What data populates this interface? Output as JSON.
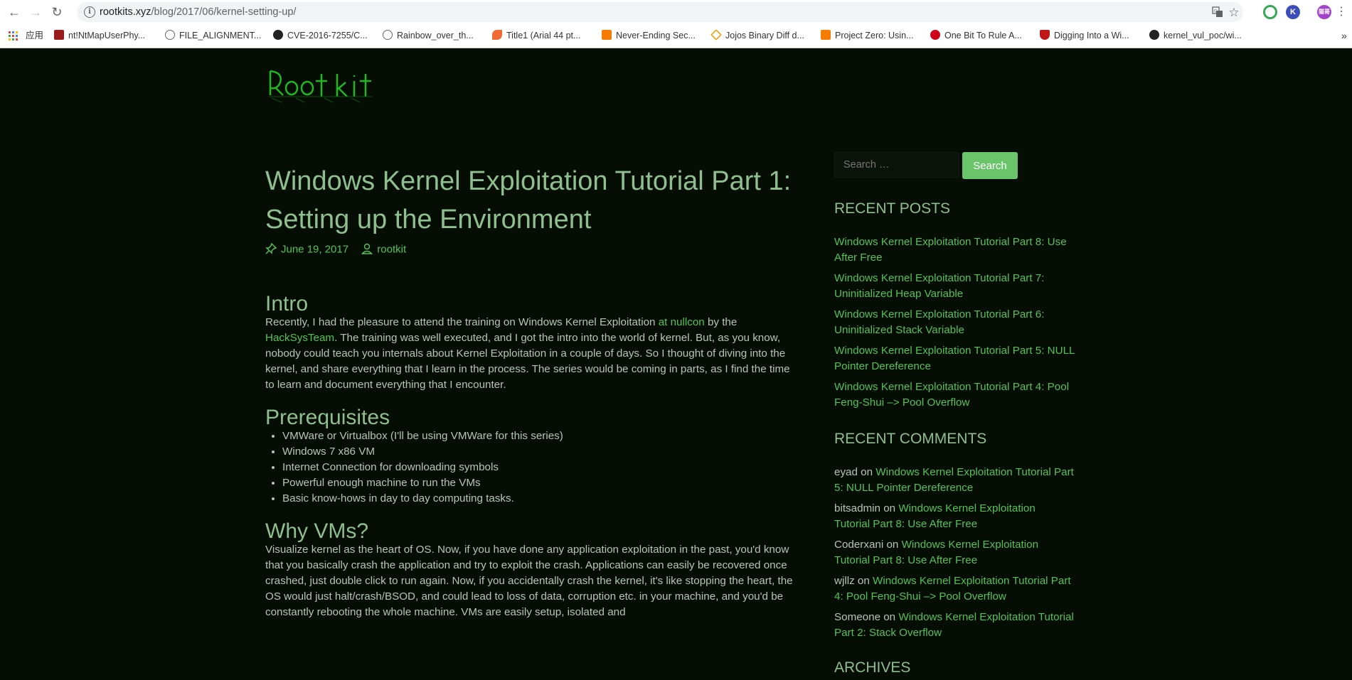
{
  "browser": {
    "url_host": "rootkits.xyz",
    "url_path": "/blog/2017/06/kernel-setting-up/",
    "apps_label": "应用",
    "bookmarks": [
      "nt!NtMapUserPhy...",
      "FILE_ALIGNMENT...",
      "CVE-2016-7255/C...",
      "Rainbow_over_th...",
      "Title1 (Arial 44 pt...",
      "Never-Ending Sec...",
      "Jojos Binary Diff d...",
      "Project Zero: Usin...",
      "One Bit To Rule A...",
      "Digging Into a Wi...",
      "kernel_vul_poc/wi..."
    ],
    "profile_label": "猫哥"
  },
  "post": {
    "title_line1": "Windows Kernel Exploitation Tutorial Part 1:",
    "title_line2": "Setting up the Environment",
    "date": "June 19, 2017",
    "author": "rootkit",
    "intro_heading": "Intro",
    "intro": {
      "t1": "Recently, I had the pleasure to attend the training on Windows Kernel Exploitation ",
      "link1": "at nullcon",
      "t2": " by the ",
      "link2": "HackSysTeam",
      "t3": ". The training was well executed, and I got the intro into the world of kernel. But, as you know, nobody could teach you internals about Kernel Exploitation in a couple of days. So I thought of diving into the kernel, and share everything that I learn in the process. The series would be coming in parts, as I find the time to learn and document everything that I encounter."
    },
    "prereq_heading": "Prerequisites",
    "prereqs": [
      "VMWare or Virtualbox (I'll be using VMWare for this series)",
      "Windows 7 x86 VM",
      "Internet Connection for downloading symbols",
      "Powerful enough machine to run the VMs",
      "Basic know-hows in day to day computing tasks."
    ],
    "why_heading": "Why VMs?",
    "why_text": "Visualize kernel as the heart of OS. Now, if you have done any application exploitation in the past, you'd know that you basically crash the application and try to exploit the crash. Applications can easily be recovered once crashed, just double click to run again. Now, if you accidentally crash the kernel, it's like stopping the heart, the OS would just halt/crash/BSOD, and could lead to loss of data, corruption etc. in your machine, and you'd be constantly rebooting the whole machine. VMs are easily setup, isolated and"
  },
  "sidebar": {
    "search_placeholder": "Search …",
    "search_button": "Search",
    "recent_posts_heading": "RECENT POSTS",
    "recent_posts": [
      {
        "line1": "Windows Kernel Exploitation Tutorial Part 8: Use",
        "line2": "After Free"
      },
      {
        "line1": "Windows Kernel Exploitation Tutorial Part 7:",
        "line2": "Uninitialized Heap Variable"
      },
      {
        "line1": "Windows Kernel Exploitation Tutorial Part 6:",
        "line2": "Uninitialized Stack Variable"
      },
      {
        "line1": "Windows Kernel Exploitation Tutorial Part 5: NULL",
        "line2": "Pointer Dereference"
      },
      {
        "line1": "Windows Kernel Exploitation Tutorial Part 4: Pool",
        "line2": "Feng-Shui –> Pool Overflow"
      }
    ],
    "recent_comments_heading": "RECENT COMMENTS",
    "recent_comments": [
      {
        "author": "eyad",
        "on": " on ",
        "link1": "Windows Kernel Exploitation Tutorial Part",
        "link2": "5: NULL Pointer Dereference"
      },
      {
        "author": "bitsadmin",
        "on": " on ",
        "link1": "Windows Kernel Exploitation",
        "link2": "Tutorial Part 8: Use After Free"
      },
      {
        "author": "Coderxani",
        "on": " on ",
        "link1": "Windows Kernel Exploitation",
        "link2": "Tutorial Part 8: Use After Free"
      },
      {
        "author": "wjllz",
        "on": " on ",
        "link1": "Windows Kernel Exploitation Tutorial Part",
        "link2": "4: Pool Feng-Shui –> Pool Overflow"
      },
      {
        "author": "Someone",
        "on": " on ",
        "link1": "Windows Kernel Exploitation Tutorial",
        "link2": "Part 2: Stack Overflow"
      }
    ],
    "archives_heading": "ARCHIVES"
  }
}
